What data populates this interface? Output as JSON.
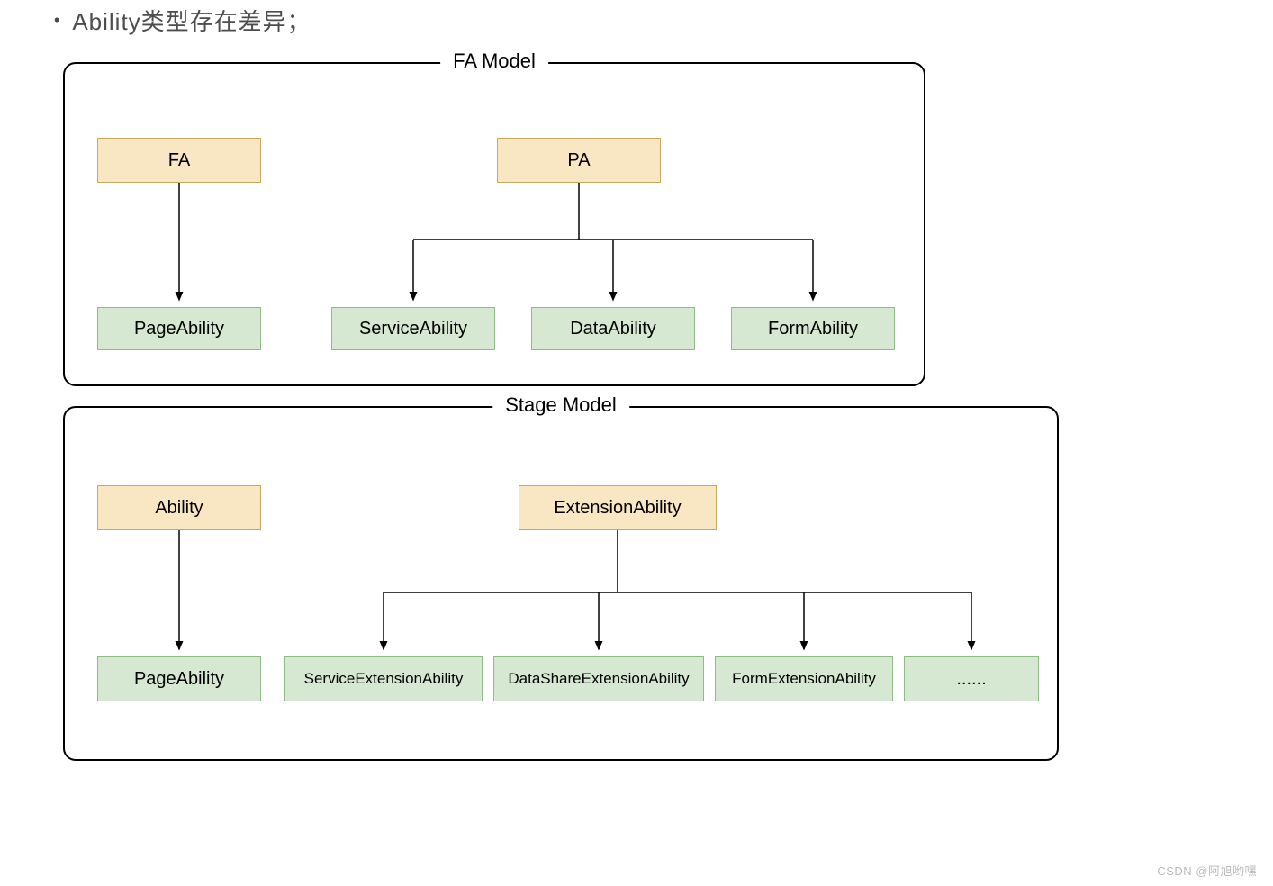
{
  "bullet": "•",
  "bullet_text": "Ability类型存在差异；",
  "fa_model": {
    "title": "FA  Model",
    "fa_box": "FA",
    "pa_box": "PA",
    "page_ability": "PageAbility",
    "service_ability": "ServiceAbility",
    "data_ability": "DataAbility",
    "form_ability": "FormAbility"
  },
  "stage_model": {
    "title": "Stage Model",
    "ability_box": "Ability",
    "extension_box": "ExtensionAbility",
    "page_ability": "PageAbility",
    "service_ext": "ServiceExtensionAbility",
    "datashare_ext": "DataShareExtensionAbility",
    "form_ext": "FormExtensionAbility",
    "more": "......"
  },
  "watermark": "CSDN @阿旭哟嘿",
  "chart_data": [
    {
      "type": "diagram",
      "title": "FA Model",
      "hierarchy": {
        "FA": [
          "PageAbility"
        ],
        "PA": [
          "ServiceAbility",
          "DataAbility",
          "FormAbility"
        ]
      }
    },
    {
      "type": "diagram",
      "title": "Stage Model",
      "hierarchy": {
        "Ability": [
          "PageAbility"
        ],
        "ExtensionAbility": [
          "ServiceExtensionAbility",
          "DataShareExtensionAbility",
          "FormExtensionAbility",
          "......"
        ]
      }
    }
  ]
}
